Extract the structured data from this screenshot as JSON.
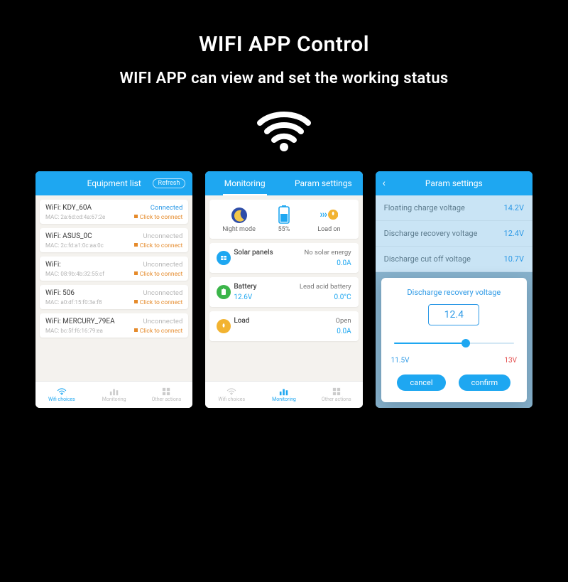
{
  "heading": {
    "title": "WIFI APP Control",
    "subtitle": "WIFI APP can view and set the working status"
  },
  "phone1": {
    "header": "Equipment list",
    "refresh_label": "Refresh",
    "click_label": "Click to connect",
    "networks": [
      {
        "ssid": "WiFi: KDY_60A",
        "mac": "MAC: 2a:6d:cd:4a:67:2e",
        "status": "Connected",
        "connected": true
      },
      {
        "ssid": "WiFi: ASUS_0C",
        "mac": "MAC: 2c:fd:a1:0c:aa:0c",
        "status": "Unconnected",
        "connected": false
      },
      {
        "ssid": "WiFi:",
        "mac": "MAC: 08:9b:4b:32:55:cf",
        "status": "Unconnected",
        "connected": false
      },
      {
        "ssid": "WiFi: 506",
        "mac": "MAC: a0:df:15:f0:3e:f8",
        "status": "Unconnected",
        "connected": false
      },
      {
        "ssid": "WiFi: MERCURY_79EA",
        "mac": "MAC: bc:5f:f6:16:79:ea",
        "status": "Unconnected",
        "connected": false
      }
    ],
    "nav": {
      "wifi": "Wifi choices",
      "mon": "Monitoring",
      "other": "Other actions"
    }
  },
  "phone2": {
    "tabs": {
      "monitoring": "Monitoring",
      "params": "Param settings"
    },
    "status": {
      "night_label": "Night mode",
      "battery_pct": "55%",
      "load_label": "Load on"
    },
    "panels": {
      "solar": {
        "title": "Solar panels",
        "state": "No solar energy",
        "val1": "",
        "val2": "0.0A"
      },
      "battery": {
        "title": "Battery",
        "state": "Lead acid battery",
        "val1": "12.6V",
        "val2": "0.0°C"
      },
      "load": {
        "title": "Load",
        "state": "Open",
        "val1": "",
        "val2": "0.0A"
      }
    },
    "nav": {
      "wifi": "Wifi choices",
      "mon": "Monitoring",
      "other": "Other actions"
    }
  },
  "phone3": {
    "header": "Param settings",
    "rows": [
      {
        "label": "Floating charge voltage",
        "value": "14.2V"
      },
      {
        "label": "Discharge recovery voltage",
        "value": "12.4V"
      },
      {
        "label": "Discharge cut off voltage",
        "value": "10.7V"
      }
    ],
    "dialog": {
      "title": "Discharge recovery voltage",
      "value": "12.4",
      "min_label": "11.5V",
      "max_label": "13V",
      "slider_pct": 60,
      "cancel": "cancel",
      "confirm": "confirm"
    }
  }
}
